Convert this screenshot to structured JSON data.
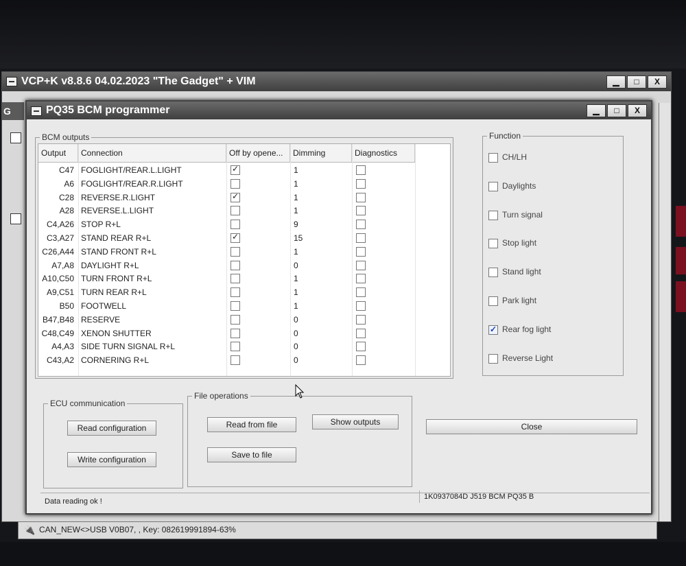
{
  "main_window": {
    "title": "VCP+K v8.8.6 04.02.2023 \"The Gadget\" + VIM",
    "tab_letter": "G",
    "status_bar": "CAN_NEW<>USB V0B07, , Key: 082619991894-63%"
  },
  "window_buttons": {
    "minimize": "▁",
    "maximize": "□",
    "close": "X"
  },
  "dialog": {
    "title": "PQ35 BCM programmer",
    "bcm_outputs": {
      "label": "BCM outputs",
      "columns": [
        "Output",
        "Connection",
        "Off by opene...",
        "Dimming",
        "Diagnostics"
      ],
      "rows": [
        {
          "output": "C47",
          "connection": "FOGLIGHT/REAR.L.LIGHT",
          "off": true,
          "dimming": "1",
          "diag": false
        },
        {
          "output": "A6",
          "connection": "FOGLIGHT/REAR.R.LIGHT",
          "off": false,
          "dimming": "1",
          "diag": false
        },
        {
          "output": "C28",
          "connection": "REVERSE.R.LIGHT",
          "off": true,
          "dimming": "1",
          "diag": false
        },
        {
          "output": "A28",
          "connection": "REVERSE.L.LIGHT",
          "off": false,
          "dimming": "1",
          "diag": false
        },
        {
          "output": "C4,A26",
          "connection": "STOP R+L",
          "off": false,
          "dimming": "9",
          "diag": false
        },
        {
          "output": "C3,A27",
          "connection": "STAND REAR R+L",
          "off": true,
          "dimming": "15",
          "diag": false
        },
        {
          "output": "C26,A44",
          "connection": "STAND FRONT R+L",
          "off": false,
          "dimming": "1",
          "diag": false
        },
        {
          "output": "A7,A8",
          "connection": "DAYLIGHT R+L",
          "off": false,
          "dimming": "0",
          "diag": false
        },
        {
          "output": "A10,C50",
          "connection": "TURN FRONT R+L",
          "off": false,
          "dimming": "1",
          "diag": false
        },
        {
          "output": "A9,C51",
          "connection": "TURN REAR R+L",
          "off": false,
          "dimming": "1",
          "diag": false
        },
        {
          "output": "B50",
          "connection": "FOOTWELL",
          "off": false,
          "dimming": "1",
          "diag": false
        },
        {
          "output": "B47,B48",
          "connection": "RESERVE",
          "off": false,
          "dimming": "0",
          "diag": false
        },
        {
          "output": "C48,C49",
          "connection": "XENON SHUTTER",
          "off": false,
          "dimming": "0",
          "diag": false
        },
        {
          "output": "A4,A3",
          "connection": "SIDE TURN SIGNAL R+L",
          "off": false,
          "dimming": "0",
          "diag": false
        },
        {
          "output": "C43,A2",
          "connection": "CORNERING R+L",
          "off": false,
          "dimming": "0",
          "diag": false
        }
      ]
    },
    "function": {
      "label": "Function",
      "items": [
        {
          "label": "CH/LH",
          "checked": false
        },
        {
          "label": "Daylights",
          "checked": false
        },
        {
          "label": "Turn signal",
          "checked": false
        },
        {
          "label": "Stop light",
          "checked": false
        },
        {
          "label": "Stand light",
          "checked": false
        },
        {
          "label": "Park light",
          "checked": false
        },
        {
          "label": "Rear fog light",
          "checked": true
        },
        {
          "label": "Reverse Light",
          "checked": false
        }
      ]
    },
    "ecu_communication": {
      "label": "ECU communication",
      "read_button": "Read configuration",
      "write_button": "Write configuration"
    },
    "file_operations": {
      "label": "File operations",
      "read_button": "Read from file",
      "save_button": "Save to file",
      "show_outputs_button": "Show outputs"
    },
    "close_button": "Close",
    "status_left": "Data reading ok !",
    "status_right": "1K0937084D  J519 BCM PQ35  B"
  }
}
